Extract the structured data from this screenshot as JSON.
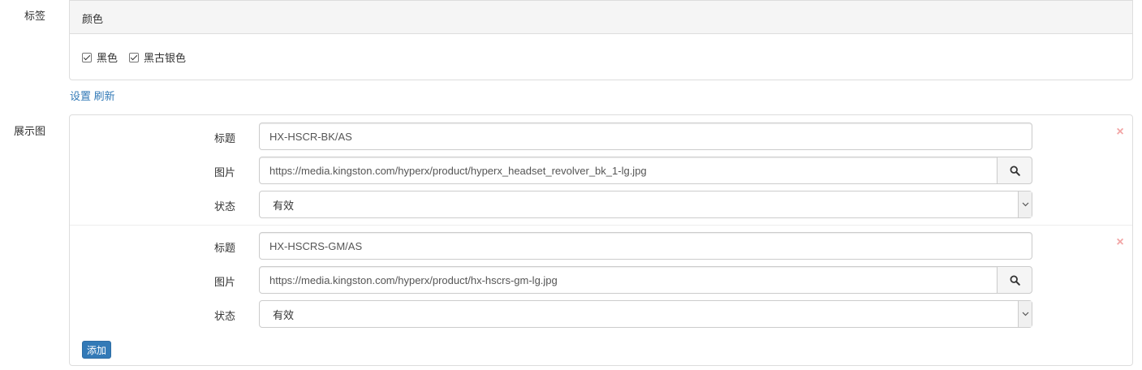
{
  "tags": {
    "label": "标签",
    "group_title": "颜色",
    "options": [
      {
        "label": "黑色",
        "checked": true
      },
      {
        "label": "黑古银色",
        "checked": true
      }
    ]
  },
  "links": {
    "settings": "设置",
    "refresh": "刷新"
  },
  "gallery": {
    "label": "展示图",
    "field_labels": {
      "title": "标题",
      "image": "图片",
      "status": "状态"
    },
    "items": [
      {
        "title": "HX-HSCR-BK/AS",
        "image": "https://media.kingston.com/hyperx/product/hyperx_headset_revolver_bk_1-lg.jpg",
        "status": "有效"
      },
      {
        "title": "HX-HSCRS-GM/AS",
        "image": "https://media.kingston.com/hyperx/product/hx-hscrs-gm-lg.jpg",
        "status": "有效"
      }
    ],
    "remove_symbol": "×",
    "add_label": "添加"
  },
  "colors": {
    "link": "#337ab7",
    "primary_button": "#337ab7",
    "remove_icon": "#f2a5a5"
  }
}
